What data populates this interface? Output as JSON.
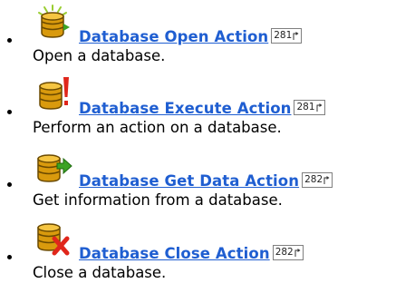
{
  "colors": {
    "link": "#1f5ed1",
    "text": "#000000"
  },
  "items": [
    {
      "icon": "database-open-icon",
      "title": "Database Open Action",
      "page_ref": "281",
      "ref_icon": "page-reference-arrow-icon",
      "description": "Open a database."
    },
    {
      "icon": "database-execute-icon",
      "title": "Database Execute Action",
      "page_ref": "281",
      "ref_icon": "page-reference-arrow-icon",
      "description": "Perform an action on a database."
    },
    {
      "icon": "database-get-data-icon",
      "title": "Database Get Data Action",
      "page_ref": "282",
      "ref_icon": "page-reference-arrow-icon",
      "description": "Get information from a database."
    },
    {
      "icon": "database-close-icon",
      "title": "Database Close Action",
      "page_ref": "282",
      "ref_icon": "page-reference-arrow-icon",
      "description": "Close a database."
    }
  ]
}
